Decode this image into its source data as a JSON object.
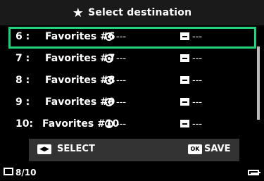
{
  "header": {
    "title": "Select destination",
    "icon": "star-icon"
  },
  "favorites": [
    {
      "num": "6 :",
      "name": "Favorites #6",
      "focus_value": "---",
      "folder_value": "---",
      "selected": true
    },
    {
      "num": "7 :",
      "name": "Favorites #7",
      "focus_value": "---",
      "folder_value": "---",
      "selected": false
    },
    {
      "num": "8 :",
      "name": "Favorites #8",
      "focus_value": "---",
      "folder_value": "---",
      "selected": false
    },
    {
      "num": "9 :",
      "name": "Favorites #9",
      "focus_value": "---",
      "folder_value": "---",
      "selected": false
    },
    {
      "num": "10:",
      "name": "Favorites #10",
      "focus_value": "---",
      "folder_value": "---",
      "selected": false
    }
  ],
  "controls": {
    "select_key": "◀▶",
    "select_label": "SELECT",
    "ok_key": "OK",
    "save_label": "SAVE"
  },
  "footer": {
    "page": "8/10"
  },
  "colors": {
    "selection": "#23d17a",
    "background": "#000000",
    "panel": "#333333"
  }
}
